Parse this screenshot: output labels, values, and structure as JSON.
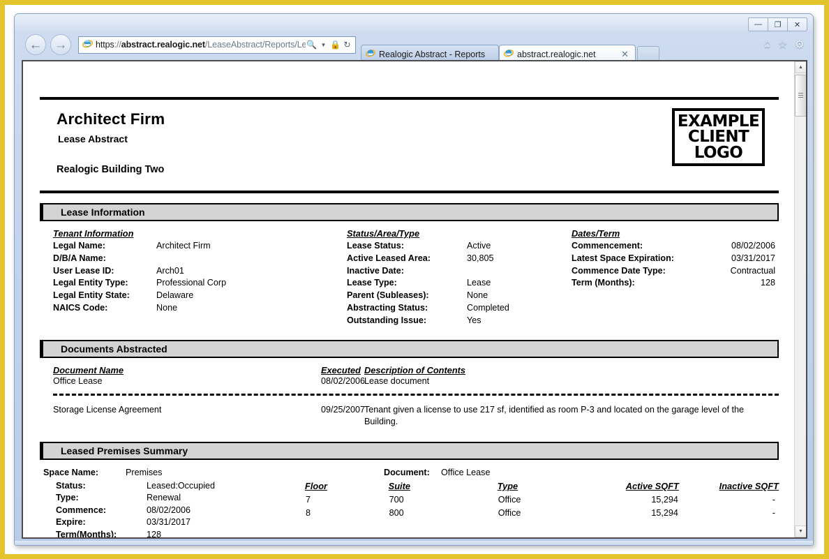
{
  "browser": {
    "window_controls": {
      "minimize": "—",
      "maximize": "❐",
      "close": "✕"
    },
    "back_label": "←",
    "forward_label": "→",
    "address": {
      "scheme": "https",
      "separator": "://",
      "domain": "abstract.realogic.net",
      "path": "/LeaseAbstract/Reports/LeaseAbstractI",
      "full_url": "https://abstract.realogic.net/LeaseAbstract/Reports/LeaseAbstractI",
      "search_icon": "search-icon",
      "dropdown_icon": "chevron-down-icon",
      "lock_icon": "lock-icon",
      "refresh_icon": "refresh-icon"
    },
    "tabs": [
      {
        "label": "Realogic Abstract - Reports",
        "active": false,
        "closable": false
      },
      {
        "label": "abstract.realogic.net",
        "active": true,
        "closable": true,
        "close_label": "✕"
      }
    ],
    "new_tab_label": "",
    "toolbar_icons": [
      {
        "name": "home-icon",
        "glyph": "⌂"
      },
      {
        "name": "favorites-icon",
        "glyph": "☆"
      },
      {
        "name": "settings-gear-icon",
        "glyph": "⚙"
      }
    ],
    "scrollbar": {
      "up_arrow": "▲",
      "down_arrow": "▼"
    }
  },
  "report": {
    "firm_name": "Architect Firm",
    "subtitle": "Lease Abstract",
    "building_name": "Realogic Building Two",
    "logo": {
      "line1": "EXAMPLE",
      "line2": "CLIENT",
      "line3": "LOGO"
    },
    "watermark": "",
    "lease_information": {
      "section_title": "Lease Information",
      "tenant_information": {
        "group_title": "Tenant Information",
        "fields": [
          {
            "label": "Legal Name:",
            "value": "Architect Firm"
          },
          {
            "label": "D/B/A Name:",
            "value": ""
          },
          {
            "label": "User Lease ID:",
            "value": "Arch01"
          },
          {
            "label": "Legal Entity Type:",
            "value": "Professional Corp"
          },
          {
            "label": "Legal Entity State:",
            "value": "Delaware"
          },
          {
            "label": "NAICS Code:",
            "value": "None"
          }
        ]
      },
      "status_area_type": {
        "group_title": "Status/Area/Type",
        "fields": [
          {
            "label": "Lease Status:",
            "value": "Active"
          },
          {
            "label": "Active Leased Area:",
            "value": "30,805"
          },
          {
            "label": "Inactive Date:",
            "value": ""
          },
          {
            "label": "Lease Type:",
            "value": "Lease"
          },
          {
            "label": "Parent (Subleases):",
            "value": "None"
          },
          {
            "label": "Abstracting Status:",
            "value": "Completed"
          },
          {
            "label": "Outstanding Issue:",
            "value": "Yes"
          }
        ]
      },
      "dates_term": {
        "group_title": "Dates/Term",
        "fields": [
          {
            "label": "Commencement:",
            "value": "08/02/2006"
          },
          {
            "label": "Latest Space Expiration:",
            "value": "03/31/2017"
          },
          {
            "label": "Commence Date Type:",
            "value": "Contractual"
          },
          {
            "label": "Term (Months):",
            "value": "128"
          }
        ]
      }
    },
    "documents_abstracted": {
      "section_title": "Documents Abstracted",
      "columns": [
        "Document Name",
        "Executed",
        "Description of Contents"
      ],
      "rows": [
        {
          "name": "Office Lease",
          "executed": "08/02/2006",
          "description": "Lease document"
        },
        {
          "name": "Storage License Agreement",
          "executed": "09/25/2007",
          "description": "Tenant given a license to use 217 sf, identified as room P-3 and located on the garage level of the Building."
        }
      ]
    },
    "leased_premises_summary": {
      "section_title": "Leased Premises Summary",
      "space_name_label": "Space Name:",
      "space_name_value": "Premises",
      "document_label": "Document:",
      "document_value": "Office Lease",
      "fields": [
        {
          "label": "Status:",
          "value": "Leased:Occupied"
        },
        {
          "label": "Type:",
          "value": "Renewal"
        },
        {
          "label": "Commence:",
          "value": "08/02/2006"
        },
        {
          "label": "Expire:",
          "value": "03/31/2017"
        },
        {
          "label": "Term(Months):",
          "value": "128"
        }
      ],
      "table": {
        "columns": [
          "Floor",
          "Suite",
          "Type",
          "Active SQFT",
          "Inactive SQFT"
        ],
        "rows": [
          {
            "floor": "7",
            "suite": "700",
            "type": "Office",
            "active_sqft": "15,294",
            "inactive_sqft": "-"
          },
          {
            "floor": "8",
            "suite": "800",
            "type": "Office",
            "active_sqft": "15,294",
            "inactive_sqft": "-"
          }
        ]
      }
    }
  },
  "colors": {
    "outer_border": "#e3c42c",
    "chrome_blue": "#c3d4ec",
    "section_bar_fill": "#d4d4d4",
    "text": "#000000",
    "url_dim": "#6f7b86"
  }
}
